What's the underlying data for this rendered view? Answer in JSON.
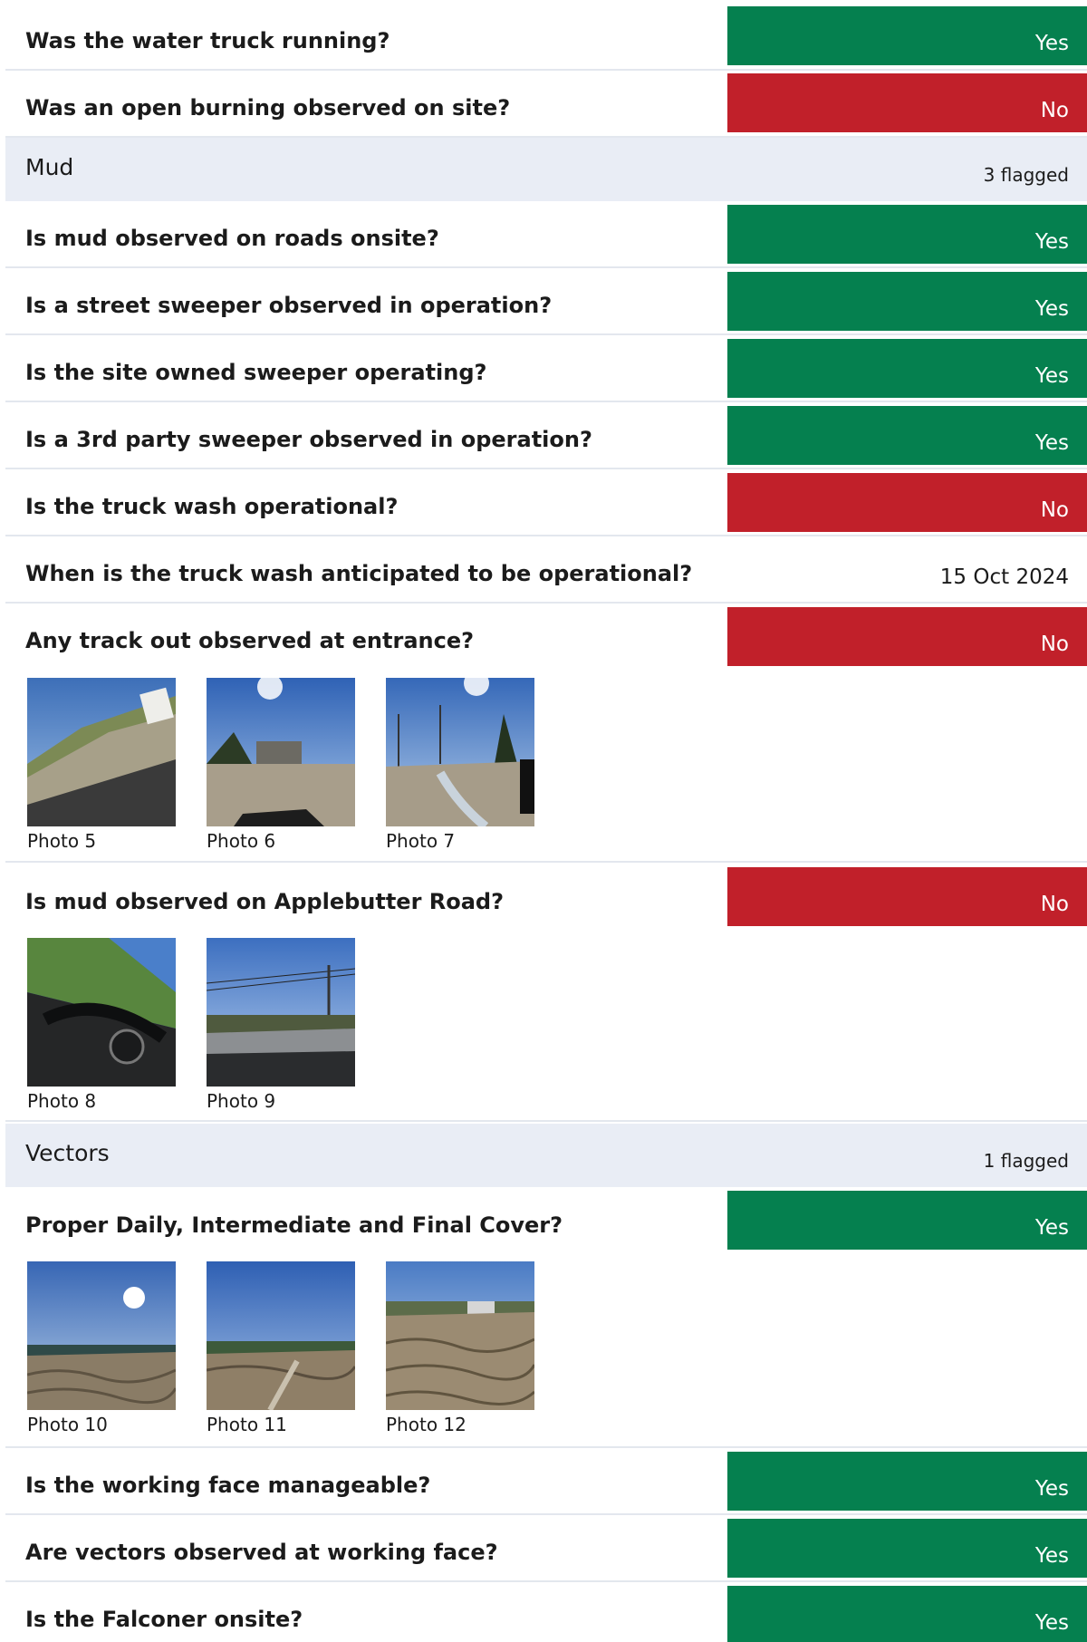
{
  "colors": {
    "yes": "#05804f",
    "no": "#c1202a",
    "section_bg": "#e9edf5",
    "divider": "#e3e7ee"
  },
  "rows": [
    {
      "question": "Was the water truck running?",
      "answer": "Yes"
    },
    {
      "question": "Was an open burning observed on site?",
      "answer": "No"
    }
  ],
  "mud": {
    "title": "Mud",
    "flagged": "3 flagged",
    "rows": [
      {
        "question": "Is mud observed  on roads onsite?",
        "answer": "Yes"
      },
      {
        "question": "Is a street sweeper observed in operation?",
        "answer": "Yes"
      },
      {
        "question": "Is the site owned sweeper operating?",
        "answer": "Yes"
      },
      {
        "question": "Is a 3rd party sweeper observed in operation?",
        "answer": "Yes"
      },
      {
        "question": "Is the truck wash operational?",
        "answer": "No"
      },
      {
        "question": "When is the truck wash anticipated to be operational?",
        "answer": "15 Oct 2024"
      },
      {
        "question": "Any track out observed at entrance?",
        "answer": "No",
        "photos": [
          "Photo 5",
          "Photo 6",
          "Photo 7"
        ]
      },
      {
        "question": "Is mud observed on Applebutter Road?",
        "answer": "No",
        "photos": [
          "Photo 8",
          "Photo 9"
        ]
      }
    ]
  },
  "vectors": {
    "title": "Vectors",
    "flagged": "1 flagged",
    "rows": [
      {
        "question": "Proper Daily, Intermediate and Final Cover?",
        "answer": "Yes",
        "photos": [
          "Photo 10",
          "Photo 11",
          "Photo 12"
        ]
      },
      {
        "question": "Is the working face manageable?",
        "answer": "Yes"
      },
      {
        "question": "Are vectors observed at working face?",
        "answer": "Yes"
      },
      {
        "question": "Is the Falconer onsite?",
        "answer": "Yes"
      }
    ]
  }
}
